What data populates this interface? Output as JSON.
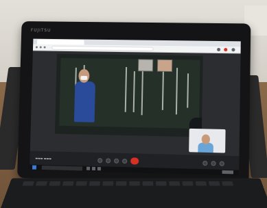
{
  "device": {
    "brand_label": "FUJITSU"
  },
  "colors": {
    "hangup": "#d93025",
    "browser_chrome": "#dee1e6",
    "meet_background": "#2b2d31",
    "shirt": "#2a4a9a"
  },
  "icons": [
    "windows-logo-icon",
    "hangup-icon",
    "microphone-icon",
    "camera-icon",
    "present-icon"
  ]
}
